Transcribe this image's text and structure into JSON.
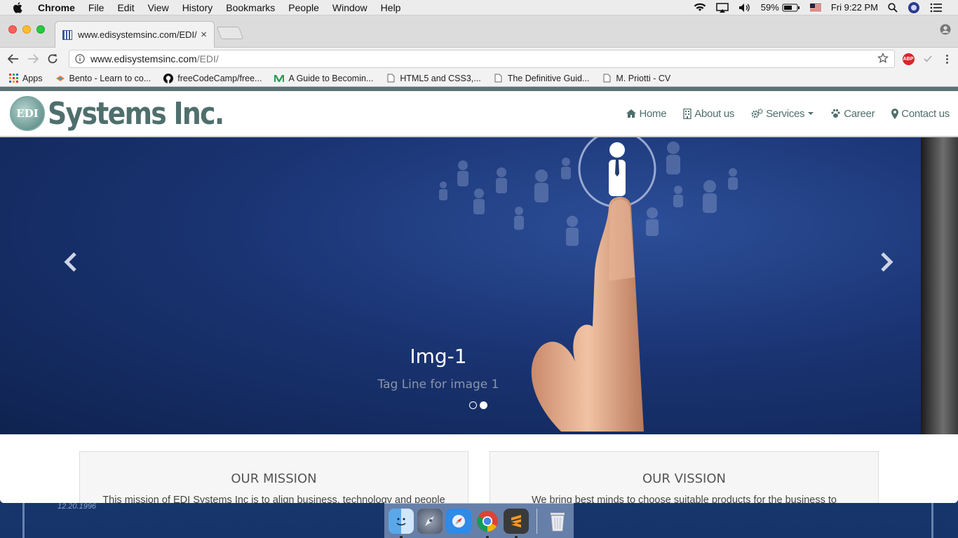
{
  "menubar": {
    "items": [
      "Chrome",
      "File",
      "Edit",
      "View",
      "History",
      "Bookmarks",
      "People",
      "Window",
      "Help"
    ],
    "battery": "59%",
    "clock": "Fri 9:22 PM"
  },
  "browser": {
    "tab_title": "www.edisystemsinc.com/EDI/",
    "tab_close": "×",
    "url_host": "www.edisystemsinc.com",
    "url_path": "/EDI/",
    "abp_label": "ABP",
    "bookmarks": [
      "Apps",
      "Bento - Learn to co...",
      "freeCodeCamp/free...",
      "A Guide to Becomin...",
      "HTML5 and CSS3,...",
      "The Definitive Guid...",
      "M. Priotti - CV"
    ]
  },
  "site": {
    "logo_badge": "EDI",
    "logo_text": "Systems Inc.",
    "nav": [
      "Home",
      "About us",
      "Services",
      "Career",
      "Contact us"
    ],
    "carousel": {
      "heading": "Img-1",
      "tagline": "Tag Line for image 1",
      "slide_count": 2,
      "active_index": 1
    },
    "cards": [
      {
        "title": "OUR MISSION",
        "text": "This mission of EDI Systems Inc is to align business, technology and people"
      },
      {
        "title": "OUR VISSION",
        "text": "We bring best minds to choose suitable products for the business to"
      }
    ]
  },
  "desktop": {
    "date_stamp": "12.20.1996"
  },
  "colors": {
    "brand": "#4f6f6c",
    "slide_bg": "#1a3473",
    "menubar_bg": "#ececec"
  }
}
